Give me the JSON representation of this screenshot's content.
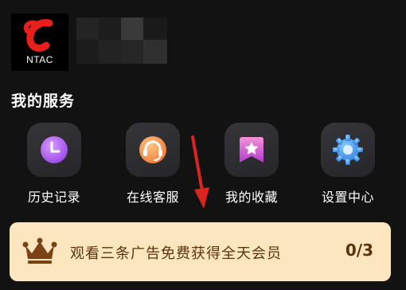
{
  "profile": {
    "avatar_text": "NTAC"
  },
  "services": {
    "title": "我的服务",
    "items": [
      {
        "label": "历史记录",
        "icon": "clock-icon"
      },
      {
        "label": "在线客服",
        "icon": "headset-icon"
      },
      {
        "label": "我的收藏",
        "icon": "bookmark-star-icon"
      },
      {
        "label": "设置中心",
        "icon": "gear-icon"
      }
    ]
  },
  "banner": {
    "text": "观看三条广告免费获得全天会员",
    "progress": "0/3",
    "icon": "crown-icon"
  },
  "colors": {
    "background": "#121212",
    "brand_red": "#e8201c",
    "banner_bg": "#fbe6bf",
    "banner_text": "#5a3410",
    "annotation_arrow": "#d9241f"
  }
}
